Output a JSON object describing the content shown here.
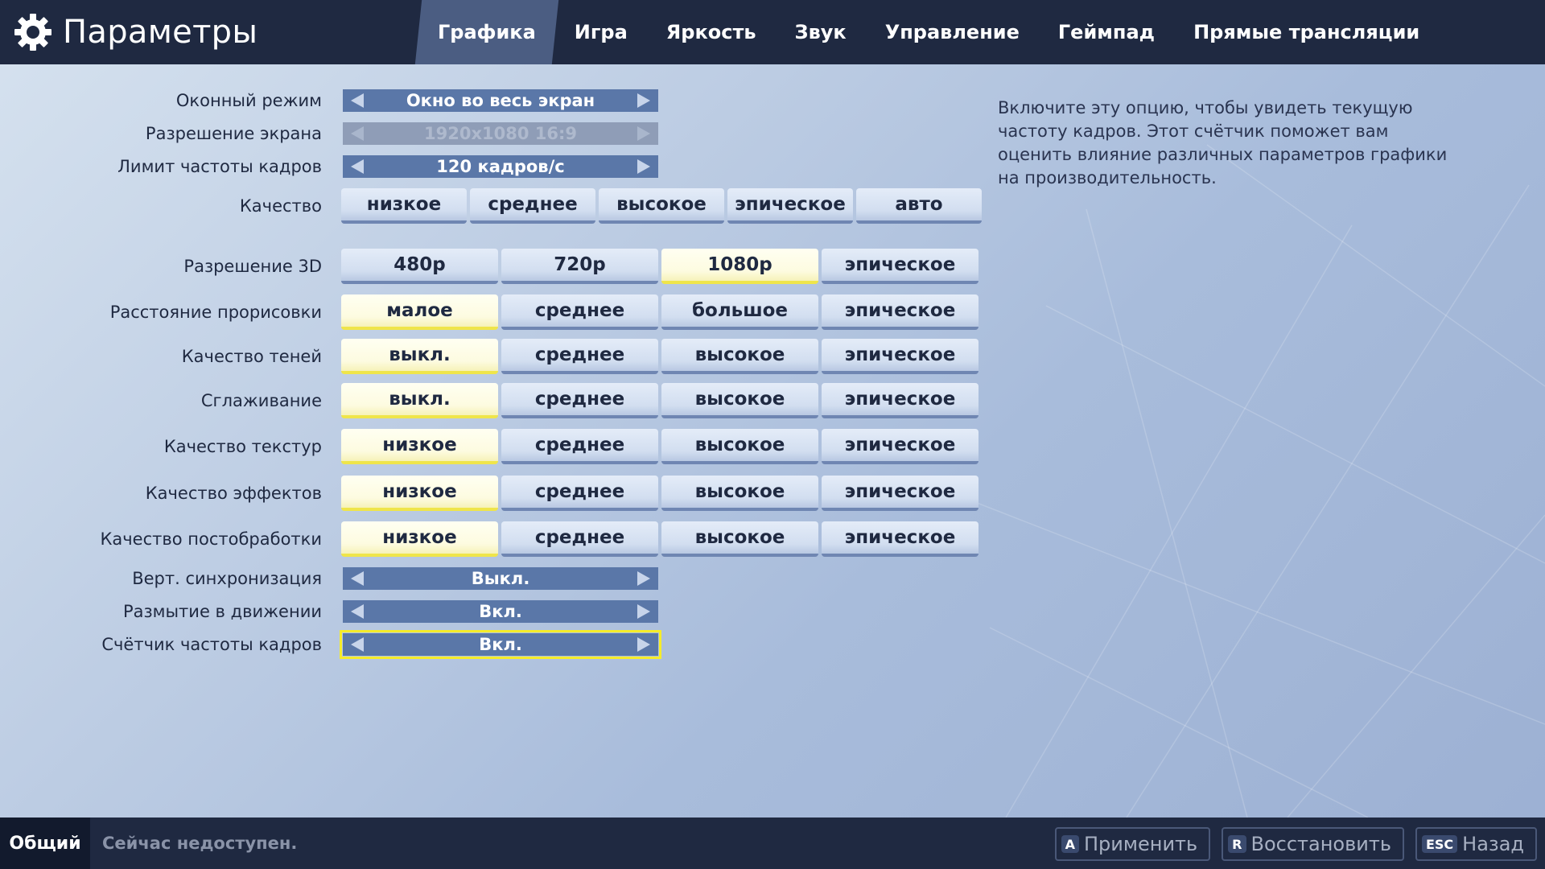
{
  "header": {
    "title": "Параметры",
    "tabs": [
      {
        "label": "Графика",
        "active": true
      },
      {
        "label": "Игра"
      },
      {
        "label": "Яркость"
      },
      {
        "label": "Звук"
      },
      {
        "label": "Управление"
      },
      {
        "label": "Геймпад"
      },
      {
        "label": "Прямые трансляции"
      }
    ]
  },
  "settings": {
    "window_mode": {
      "label": "Оконный режим",
      "value": "Окно во весь экран"
    },
    "resolution": {
      "label": "Разрешение экрана",
      "value": "1920x1080 16:9"
    },
    "fps_limit": {
      "label": "Лимит частоты кадров",
      "value": "120 кадров/с"
    },
    "quality": {
      "label": "Качество",
      "options": [
        "низкое",
        "среднее",
        "высокое",
        "эпическое",
        "авто"
      ]
    },
    "res3d": {
      "label": "Разрешение 3D",
      "options": [
        "480p",
        "720p",
        "1080p",
        "эпическое"
      ],
      "selected": "1080p"
    },
    "view_distance": {
      "label": "Расстояние прорисовки",
      "options": [
        "малое",
        "среднее",
        "большое",
        "эпическое"
      ],
      "selected": "малое"
    },
    "shadows": {
      "label": "Качество теней",
      "options": [
        "выкл.",
        "среднее",
        "высокое",
        "эпическое"
      ],
      "selected": "выкл."
    },
    "antialiasing": {
      "label": "Сглаживание",
      "options": [
        "выкл.",
        "среднее",
        "высокое",
        "эпическое"
      ],
      "selected": "выкл."
    },
    "textures": {
      "label": "Качество текстур",
      "options": [
        "низкое",
        "среднее",
        "высокое",
        "эпическое"
      ],
      "selected": "низкое"
    },
    "effects": {
      "label": "Качество эффектов",
      "options": [
        "низкое",
        "среднее",
        "высокое",
        "эпическое"
      ],
      "selected": "низкое"
    },
    "postprocess": {
      "label": "Качество постобработки",
      "options": [
        "низкое",
        "среднее",
        "высокое",
        "эпическое"
      ],
      "selected": "низкое"
    },
    "vsync": {
      "label": "Верт. синхронизация",
      "value": "Выкл."
    },
    "motion_blur": {
      "label": "Размытие в движении",
      "value": "Вкл."
    },
    "fps_counter": {
      "label": "Счётчик частоты кадров",
      "value": "Вкл."
    }
  },
  "description": "Включите эту опцию, чтобы увидеть текущую частоту кадров. Этот счётчик поможет вам оценить влияние различных параметров графики на производительность.",
  "footer": {
    "tab": "Общий",
    "status": "Сейчас недоступен.",
    "actions": [
      {
        "key": "A",
        "label": "Применить"
      },
      {
        "key": "R",
        "label": "Восстановить"
      },
      {
        "key": "ESC",
        "label": "Назад"
      }
    ]
  },
  "colors": {
    "header_bg": "#1f2941",
    "selector_bg": "#5a77a8",
    "selected_option": "#fdfbe0",
    "focus_outline": "#f5ec2a"
  }
}
